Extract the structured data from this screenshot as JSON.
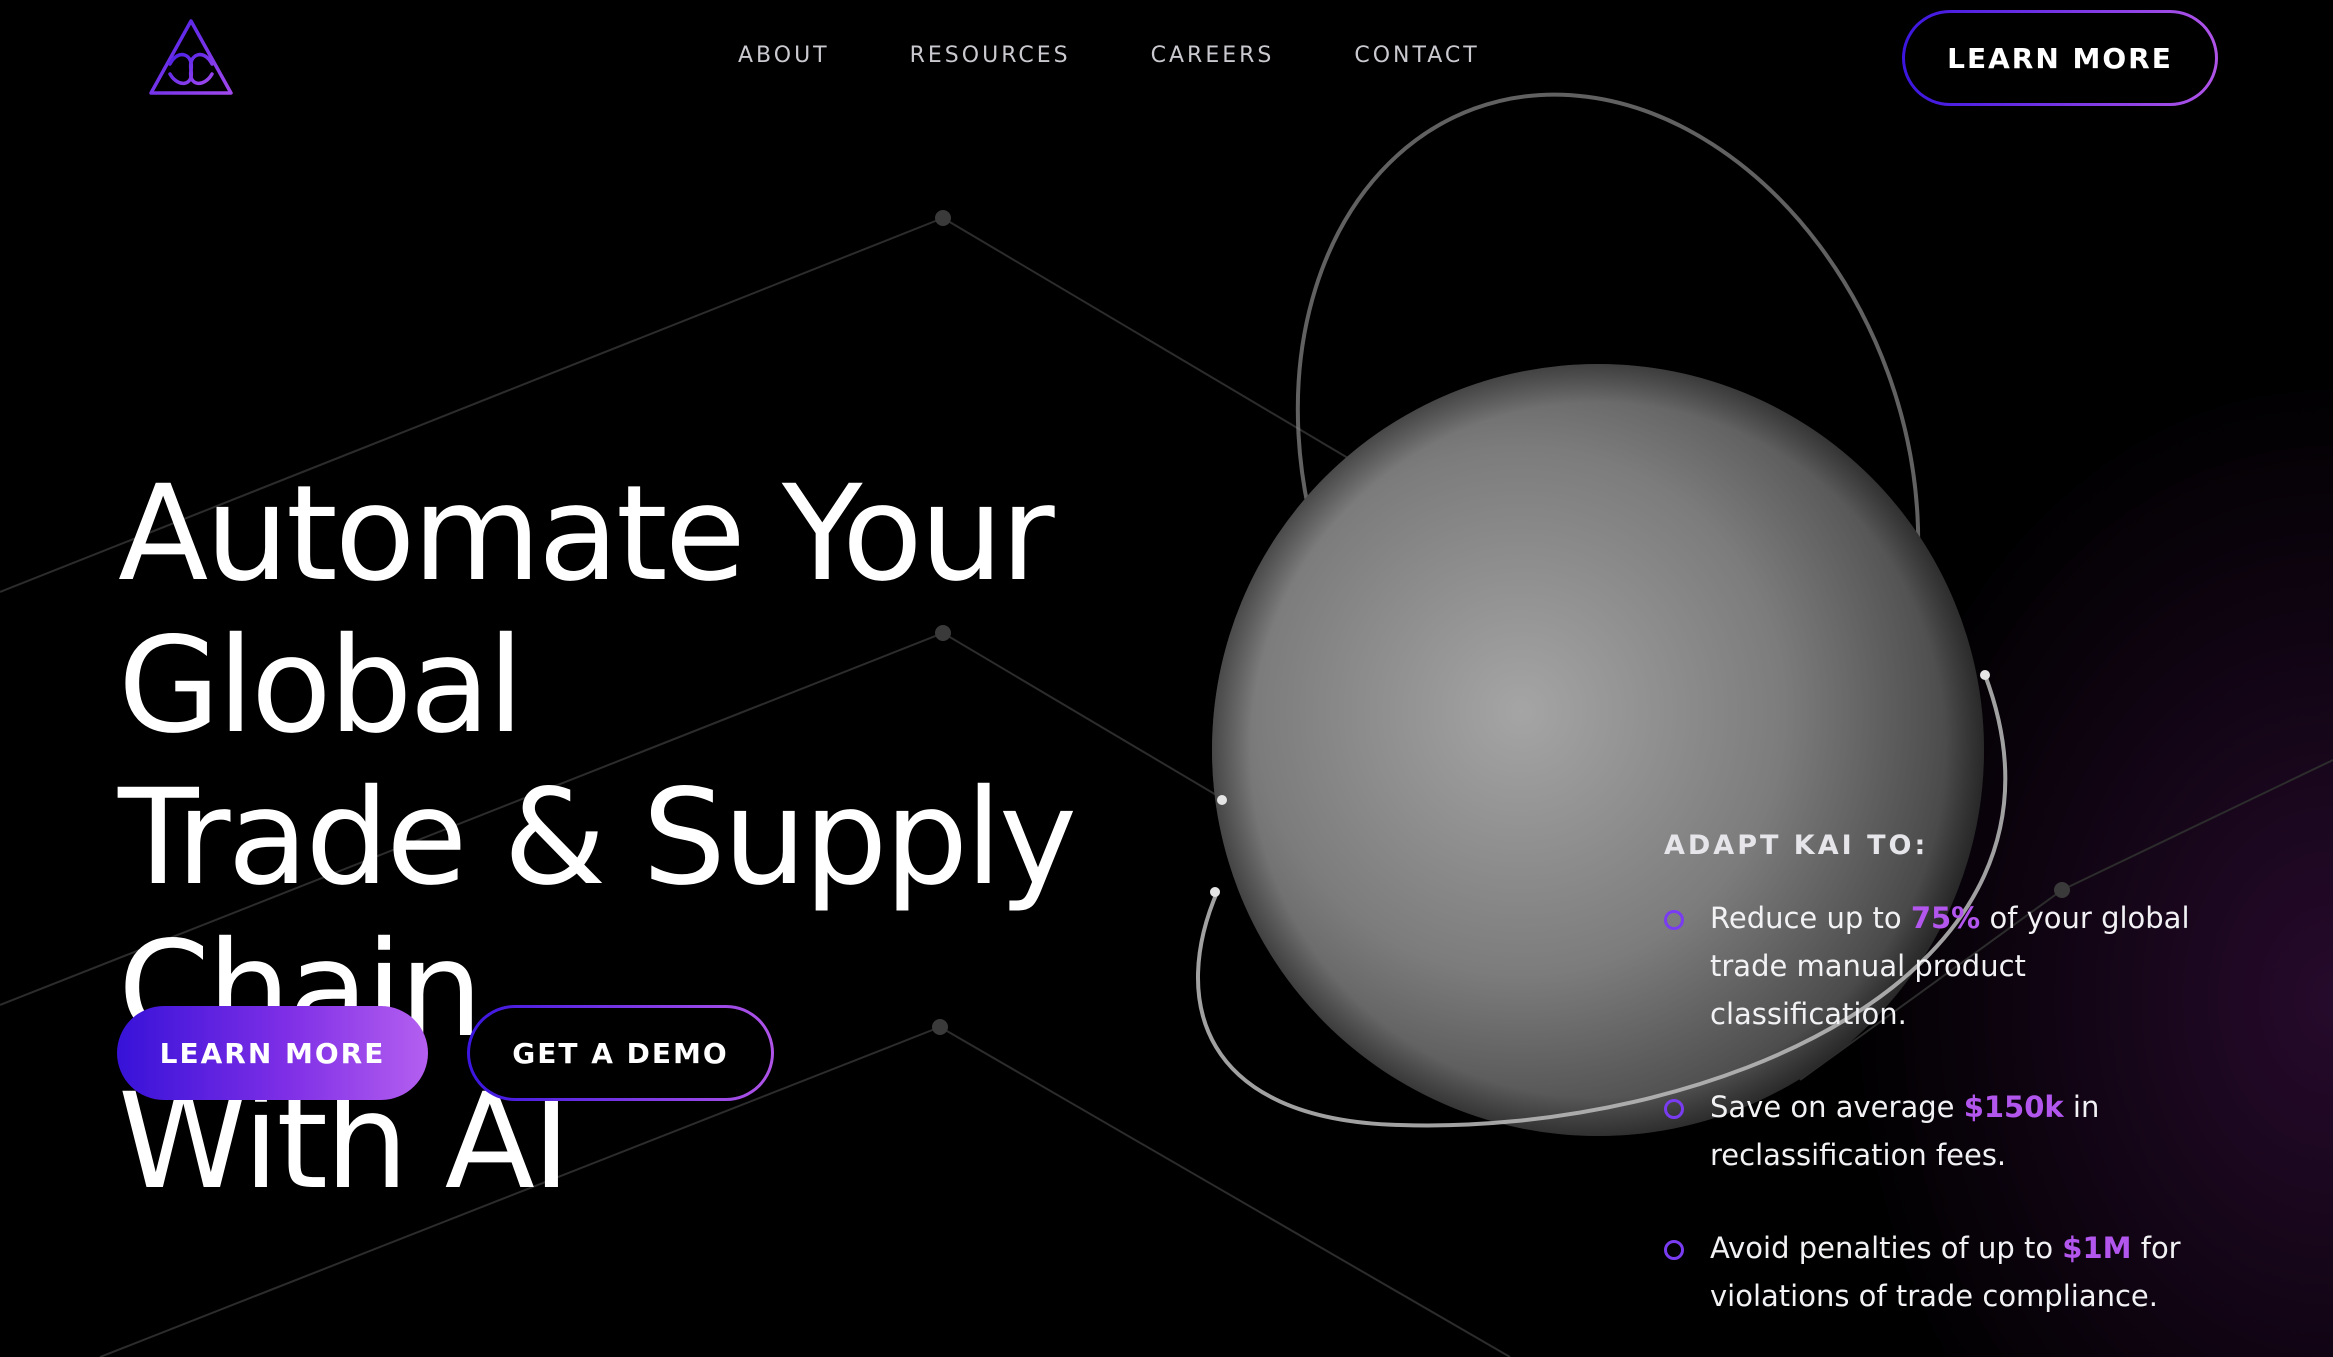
{
  "header": {
    "logo_icon": "triangle-knot-logo-icon",
    "nav": [
      {
        "label": "ABOUT"
      },
      {
        "label": "RESOURCES"
      },
      {
        "label": "CAREERS"
      },
      {
        "label": "CONTACT"
      }
    ],
    "cta_label": "LEARN MORE"
  },
  "hero": {
    "title_lines": [
      "Automate Your Global",
      "Trade & Supply Chain",
      "With AI"
    ],
    "primary_button_label": "LEARN MORE",
    "secondary_button_label": "GET A DEMO"
  },
  "benefits": {
    "heading": "ADAPT KAI TO:",
    "items": [
      {
        "before": "Reduce up to ",
        "highlight": "75%",
        "after": " of your global trade manual product classification."
      },
      {
        "before": "Save on average ",
        "highlight": "$150k",
        "after": " in reclassification fees."
      },
      {
        "before": "Avoid penalties of up to ",
        "highlight": "$1M",
        "after": " for violations of trade compliance."
      }
    ]
  },
  "colors": {
    "background": "#000000",
    "accent_start": "#3712d8",
    "accent_end": "#b45ff0",
    "highlight": "#b256ee"
  }
}
